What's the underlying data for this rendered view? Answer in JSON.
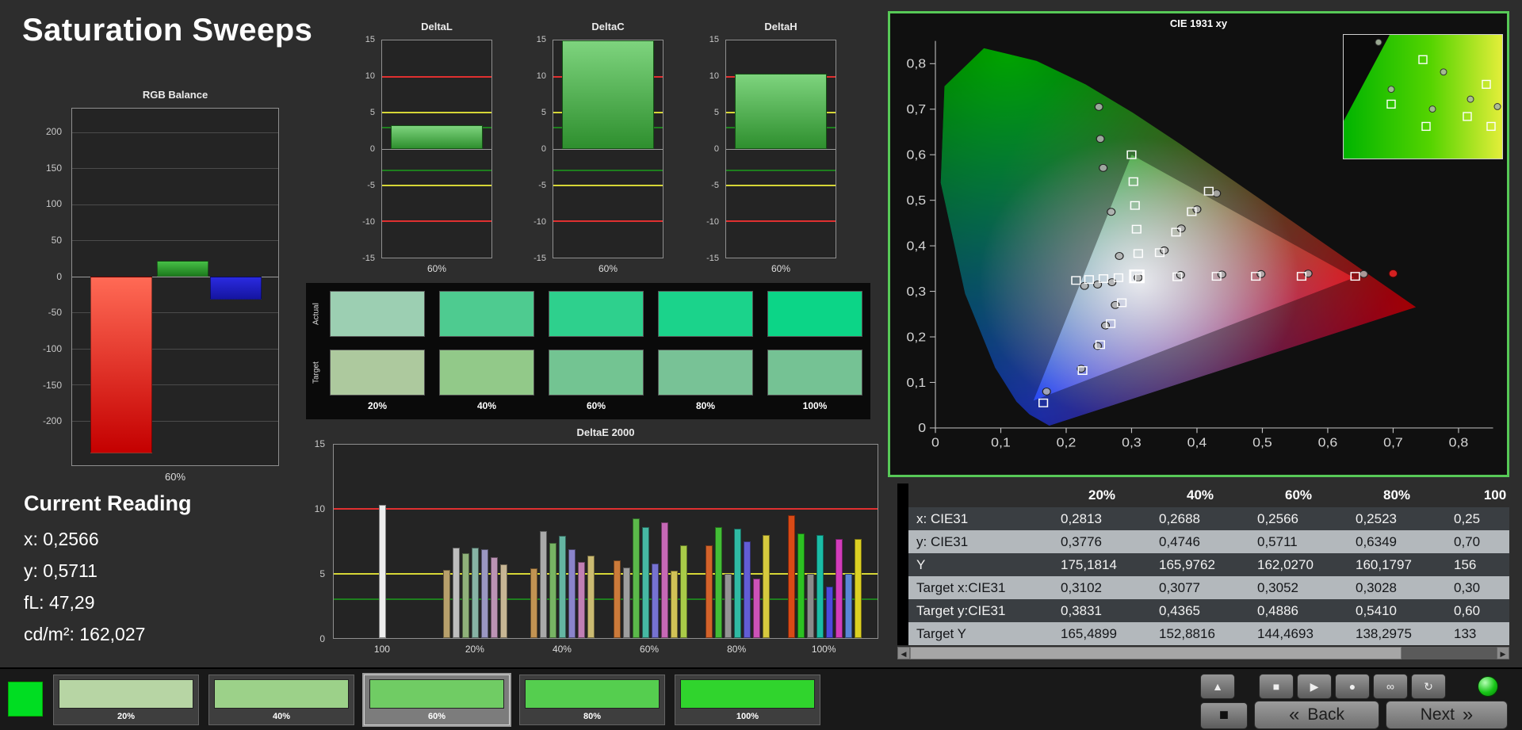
{
  "title": "Saturation Sweeps",
  "rgb_balance": {
    "title": "RGB Balance",
    "xlabel": "60%",
    "ylim": [
      -262,
      233
    ],
    "yticks": [
      200,
      150,
      100,
      50,
      0,
      -50,
      -100,
      -150,
      -200
    ],
    "bars": [
      {
        "name": "red",
        "value": -245,
        "color_top": "#ff6a55",
        "color_bottom": "#c40000"
      },
      {
        "name": "green",
        "value": 22,
        "color_top": "#46c046",
        "color_bottom": "#1d7a1d"
      },
      {
        "name": "blue",
        "value": -32,
        "color_top": "#2a2ae0",
        "color_bottom": "#1515a0"
      }
    ]
  },
  "current_reading": {
    "title": "Current Reading",
    "lines": [
      "x: 0,2566",
      "y: 0,5711",
      "fL: 47,29",
      "cd/m²: 162,027"
    ]
  },
  "delta_axis": {
    "ylim": [
      -15,
      15
    ],
    "yticks": [
      15,
      10,
      5,
      0,
      -5,
      -10,
      -15
    ],
    "ref_lines": [
      {
        "value": 10,
        "color": "#e03030"
      },
      {
        "value": 5,
        "color": "#d6d636"
      },
      {
        "value": 3,
        "color": "#1e7f1e"
      }
    ]
  },
  "delta_charts": [
    {
      "title": "DeltaL",
      "xlabel": "60%",
      "value": 3.3
    },
    {
      "title": "DeltaC",
      "xlabel": "60%",
      "value": 15.4
    },
    {
      "title": "DeltaH",
      "xlabel": "60%",
      "value": 10.4
    }
  ],
  "swatch_compare": {
    "row_labels": [
      "Actual",
      "Target"
    ],
    "col_labels": [
      "20%",
      "40%",
      "60%",
      "80%",
      "100%"
    ],
    "actual": [
      "#9ccfb2",
      "#4ecb90",
      "#2ed08d",
      "#1bd38b",
      "#0cd587"
    ],
    "target": [
      "#adc99e",
      "#92c989",
      "#73c492",
      "#78c296",
      "#75c294"
    ]
  },
  "deltae": {
    "title": "DeltaE 2000",
    "ylim": [
      0,
      15
    ],
    "yticks": [
      15,
      10,
      5,
      0
    ],
    "ref_lines": [
      {
        "value": 10,
        "color": "#e03030"
      },
      {
        "value": 5,
        "color": "#d6d636"
      },
      {
        "value": 3,
        "color": "#1e7f1e"
      }
    ],
    "group_centers": [
      9,
      26,
      42,
      58,
      74,
      90
    ],
    "groups": [
      {
        "label": "100",
        "bars": [
          {
            "v": 10.3,
            "c": "#ededed"
          }
        ]
      },
      {
        "label": "20%",
        "bars": [
          {
            "v": 5.3,
            "c": "#b7a06b"
          },
          {
            "v": 7.0,
            "c": "#bdbdbd"
          },
          {
            "v": 6.6,
            "c": "#8fb17a"
          },
          {
            "v": 7.0,
            "c": "#87b3a5"
          },
          {
            "v": 6.9,
            "c": "#9a97c2"
          },
          {
            "v": 6.3,
            "c": "#bb93b4"
          },
          {
            "v": 5.7,
            "c": "#c7b694"
          }
        ]
      },
      {
        "label": "40%",
        "bars": [
          {
            "v": 5.4,
            "c": "#c29352"
          },
          {
            "v": 8.3,
            "c": "#a9a9a9"
          },
          {
            "v": 7.4,
            "c": "#77b463"
          },
          {
            "v": 7.9,
            "c": "#64b5a2"
          },
          {
            "v": 6.9,
            "c": "#8a84cb"
          },
          {
            "v": 5.9,
            "c": "#c07fb4"
          },
          {
            "v": 6.4,
            "c": "#cbbb72"
          }
        ]
      },
      {
        "label": "60%",
        "bars": [
          {
            "v": 6.0,
            "c": "#cb7a3a"
          },
          {
            "v": 5.5,
            "c": "#9e9e9e"
          },
          {
            "v": 9.3,
            "c": "#5bb94a"
          },
          {
            "v": 8.6,
            "c": "#46b8a3"
          },
          {
            "v": 5.8,
            "c": "#7672d1"
          },
          {
            "v": 9.0,
            "c": "#c668b6"
          },
          {
            "v": 5.2,
            "c": "#d1c256"
          },
          {
            "v": 7.2,
            "c": "#a9cb48"
          }
        ]
      },
      {
        "label": "80%",
        "bars": [
          {
            "v": 7.2,
            "c": "#d2622a"
          },
          {
            "v": 8.6,
            "c": "#43bd36"
          },
          {
            "v": 5.0,
            "c": "#949494"
          },
          {
            "v": 8.5,
            "c": "#2fbaa4"
          },
          {
            "v": 7.5,
            "c": "#625dd6"
          },
          {
            "v": 4.6,
            "c": "#cc52b8"
          },
          {
            "v": 8.0,
            "c": "#d6c93e"
          }
        ]
      },
      {
        "label": "100%",
        "bars": [
          {
            "v": 9.5,
            "c": "#d94a16"
          },
          {
            "v": 8.1,
            "c": "#2cc122"
          },
          {
            "v": 5.0,
            "c": "#8a8a8a"
          },
          {
            "v": 8.0,
            "c": "#1abda6"
          },
          {
            "v": 4.0,
            "c": "#4e49dc"
          },
          {
            "v": 7.7,
            "c": "#d23cba"
          },
          {
            "v": 5.0,
            "c": "#5a86d6"
          },
          {
            "v": 7.7,
            "c": "#dcd023"
          }
        ]
      }
    ]
  },
  "cie": {
    "title": "CIE 1931 xy",
    "xticks": [
      "0",
      "0,1",
      "0,2",
      "0,3",
      "0,4",
      "0,5",
      "0,6",
      "0,7",
      "0,8"
    ],
    "yticks": [
      "0",
      "0,1",
      "0,2",
      "0,3",
      "0,4",
      "0,5",
      "0,6",
      "0,7",
      "0,8"
    ],
    "current_target": [
      0.308,
      0.333
    ],
    "red_point": [
      0.7,
      0.339
    ],
    "target_squares": [
      [
        0.3102,
        0.3831
      ],
      [
        0.3077,
        0.4365
      ],
      [
        0.3052,
        0.4886
      ],
      [
        0.3028,
        0.541
      ],
      [
        0.3,
        0.6
      ],
      [
        0.37,
        0.332
      ],
      [
        0.43,
        0.333
      ],
      [
        0.49,
        0.333
      ],
      [
        0.56,
        0.333
      ],
      [
        0.642,
        0.333
      ],
      [
        0.285,
        0.275
      ],
      [
        0.268,
        0.229
      ],
      [
        0.252,
        0.183
      ],
      [
        0.225,
        0.126
      ],
      [
        0.165,
        0.055
      ],
      [
        0.343,
        0.385
      ],
      [
        0.368,
        0.43
      ],
      [
        0.392,
        0.475
      ],
      [
        0.418,
        0.52
      ],
      [
        0.28,
        0.33
      ],
      [
        0.257,
        0.328
      ],
      [
        0.235,
        0.326
      ],
      [
        0.215,
        0.324
      ],
      [
        0.3127,
        0.329
      ]
    ],
    "measured_circles": [
      [
        0.2813,
        0.3776
      ],
      [
        0.2688,
        0.4746
      ],
      [
        0.2566,
        0.5711
      ],
      [
        0.2523,
        0.6349
      ],
      [
        0.25,
        0.705
      ],
      [
        0.375,
        0.336
      ],
      [
        0.438,
        0.337
      ],
      [
        0.498,
        0.338
      ],
      [
        0.57,
        0.339
      ],
      [
        0.655,
        0.338
      ],
      [
        0.275,
        0.27
      ],
      [
        0.26,
        0.225
      ],
      [
        0.248,
        0.18
      ],
      [
        0.223,
        0.13
      ],
      [
        0.17,
        0.08
      ],
      [
        0.35,
        0.39
      ],
      [
        0.376,
        0.438
      ],
      [
        0.4,
        0.48
      ],
      [
        0.43,
        0.515
      ],
      [
        0.27,
        0.32
      ],
      [
        0.248,
        0.315
      ],
      [
        0.228,
        0.312
      ],
      [
        0.31,
        0.33
      ]
    ],
    "inset": {
      "squares": [
        [
          0.5,
          0.2
        ],
        [
          0.3,
          0.56
        ],
        [
          0.52,
          0.74
        ],
        [
          0.78,
          0.66
        ],
        [
          0.93,
          0.74
        ],
        [
          0.9,
          0.4
        ]
      ],
      "circles": [
        [
          0.22,
          0.06
        ],
        [
          0.3,
          0.44
        ],
        [
          0.56,
          0.6
        ],
        [
          0.8,
          0.52
        ],
        [
          0.97,
          0.58
        ],
        [
          0.63,
          0.3
        ]
      ]
    }
  },
  "table": {
    "scroll_left_icon": "◀",
    "scroll_right_icon": "▶",
    "columns": [
      "20%",
      "40%",
      "60%",
      "80%",
      "100"
    ],
    "rows": [
      {
        "label": "x: CIE31",
        "values": [
          "0,2813",
          "0,2688",
          "0,2566",
          "0,2523",
          "0,25"
        ]
      },
      {
        "label": "y: CIE31",
        "values": [
          "0,3776",
          "0,4746",
          "0,5711",
          "0,6349",
          "0,70"
        ]
      },
      {
        "label": "Y",
        "values": [
          "175,1814",
          "165,9762",
          "162,0270",
          "160,1797",
          "156"
        ]
      },
      {
        "label": "Target x:CIE31",
        "values": [
          "0,3102",
          "0,3077",
          "0,3052",
          "0,3028",
          "0,30"
        ]
      },
      {
        "label": "Target y:CIE31",
        "values": [
          "0,3831",
          "0,4365",
          "0,4886",
          "0,5410",
          "0,60"
        ]
      },
      {
        "label": "Target Y",
        "values": [
          "165,4899",
          "152,8816",
          "144,4693",
          "138,2975",
          "133"
        ]
      }
    ]
  },
  "bottom": {
    "pattern_color": "#00dd22",
    "swatches": [
      {
        "label": "20%",
        "color": "#b7d5a4",
        "selected": false
      },
      {
        "label": "40%",
        "color": "#9cd189",
        "selected": false
      },
      {
        "label": "60%",
        "color": "#70cc64",
        "selected": true
      },
      {
        "label": "80%",
        "color": "#55ce4f",
        "selected": false
      },
      {
        "label": "100%",
        "color": "#30d42d",
        "selected": false
      }
    ],
    "transport": {
      "collapse_icon": "▲",
      "stop_icon": "■",
      "play_icon": "▶",
      "record_icon": "●",
      "loop_icon": "∞",
      "refresh_icon": "↻",
      "big_stop_icon": "◼"
    },
    "back_chevron": "«",
    "back_label": "Back",
    "next_label": "Next",
    "next_chevron": "»"
  }
}
